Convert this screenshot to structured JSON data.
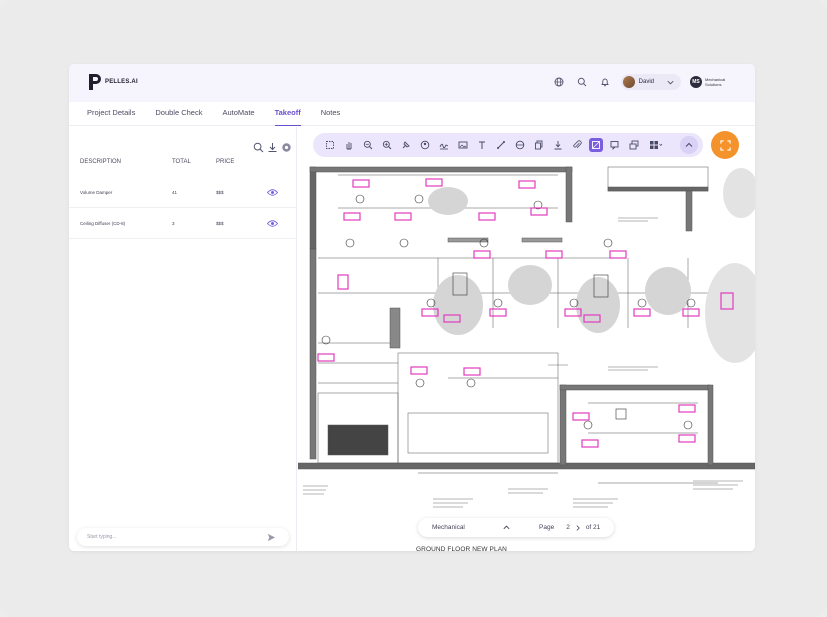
{
  "brand": {
    "name": "PELLES.AI",
    "accent": "#6a4fcf",
    "fab": "#f4922b",
    "marker": "#e23bbf"
  },
  "header": {
    "user_name": "David",
    "org_name": "Mechanical Solutions",
    "icons": [
      "globe-icon",
      "search-icon",
      "bell-icon",
      "chevron-down-icon"
    ]
  },
  "tabs": [
    {
      "label": "Project Details"
    },
    {
      "label": "Double Check"
    },
    {
      "label": "AutoMate"
    },
    {
      "label": "Takeoff",
      "active": true
    },
    {
      "label": "Notes"
    }
  ],
  "takeoff": {
    "columns": {
      "description": "DESCRIPTION",
      "total": "TOTAL",
      "price": "PRICE"
    },
    "rows": [
      {
        "description": "Volume Damper",
        "total": "41",
        "price": "$$$"
      },
      {
        "description": "Ceiling Diffuser (CD-8)",
        "total": "3",
        "price": "$$$"
      }
    ]
  },
  "chat": {
    "placeholder": "Start typing..."
  },
  "toolbar": {
    "tools": [
      "select-icon",
      "pan-icon",
      "zoom-out-icon",
      "zoom-in-icon",
      "pin-icon",
      "stamp-icon",
      "signature-icon",
      "image-icon",
      "text-icon",
      "line-icon",
      "measure-icon",
      "copy-icon",
      "download-icon",
      "attach-icon",
      "area-icon",
      "comment-icon",
      "layers-icon",
      "grid-icon"
    ],
    "selected": "area-icon"
  },
  "pager": {
    "discipline": "Mechanical",
    "page_label": "Page",
    "page": "2",
    "of": "of 21"
  },
  "drawing": {
    "title": "GROUND FLOOR NEW PLAN"
  }
}
